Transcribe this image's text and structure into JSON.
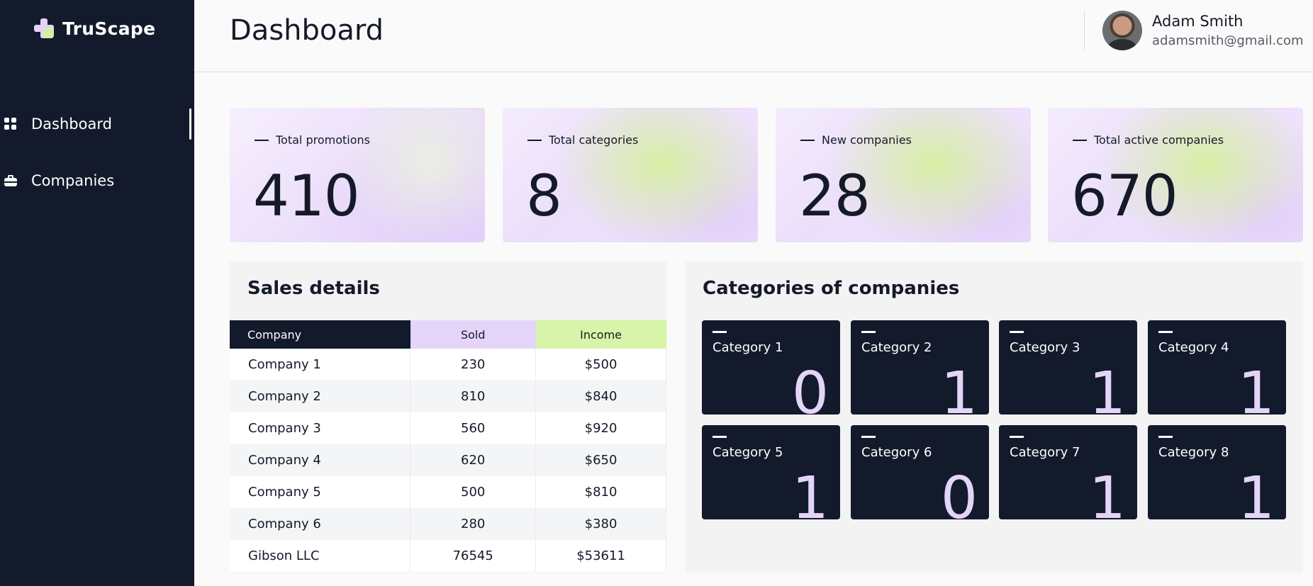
{
  "app": {
    "name": "TruScape"
  },
  "sidebar": {
    "items": [
      {
        "label": "Dashboard",
        "icon": "grid-icon",
        "active": true
      },
      {
        "label": "Companies",
        "icon": "briefcase-icon",
        "active": false
      }
    ]
  },
  "header": {
    "title": "Dashboard",
    "user": {
      "name": "Adam Smith",
      "email": "adamsmith@gmail.com"
    }
  },
  "stats": [
    {
      "label": "Total promotions",
      "value": "410"
    },
    {
      "label": "Total categories",
      "value": "8"
    },
    {
      "label": "New companies",
      "value": "28"
    },
    {
      "label": "Total active companies",
      "value": "670"
    }
  ],
  "sales": {
    "title": "Sales details",
    "columns": [
      "Company",
      "Sold",
      "Income"
    ],
    "rows": [
      {
        "company": "Company 1",
        "sold": "230",
        "income": "$500"
      },
      {
        "company": "Company 2",
        "sold": "810",
        "income": "$840"
      },
      {
        "company": "Company 3",
        "sold": "560",
        "income": "$920"
      },
      {
        "company": "Company 4",
        "sold": "620",
        "income": "$650"
      },
      {
        "company": "Company 5",
        "sold": "500",
        "income": "$810"
      },
      {
        "company": "Company 6",
        "sold": "280",
        "income": "$380"
      },
      {
        "company": "Gibson LLC",
        "sold": "76545",
        "income": "$53611"
      }
    ]
  },
  "categories": {
    "title": "Categories of companies",
    "items": [
      {
        "name": "Category 1",
        "count": "0"
      },
      {
        "name": "Category 2",
        "count": "1"
      },
      {
        "name": "Category 3",
        "count": "1"
      },
      {
        "name": "Category 4",
        "count": "1"
      },
      {
        "name": "Category 5",
        "count": "1"
      },
      {
        "name": "Category 6",
        "count": "0"
      },
      {
        "name": "Category 7",
        "count": "1"
      },
      {
        "name": "Category 8",
        "count": "1"
      }
    ]
  },
  "colors": {
    "sidebar_bg": "#131a2b",
    "accent_lavender": "#e5d4fa",
    "accent_lime": "#d7f4a8",
    "text_dark": "#151a28"
  }
}
